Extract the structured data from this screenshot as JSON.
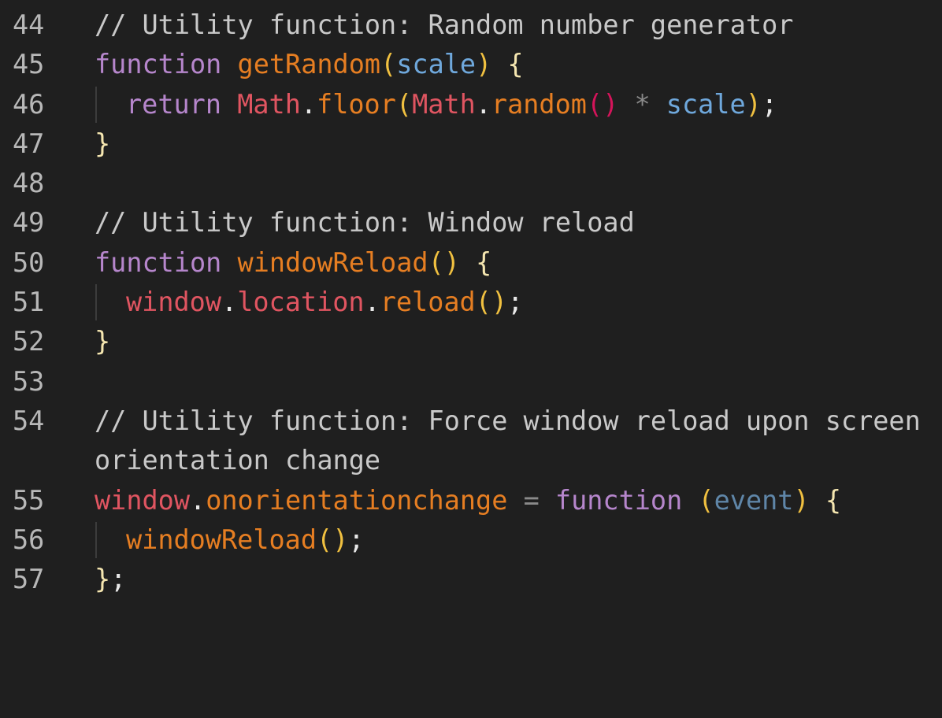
{
  "lines": [
    {
      "number": "44",
      "tokens": [
        "// Utility function: Random number generator"
      ]
    },
    {
      "number": "45",
      "tokens": [
        "function",
        " ",
        "getRandom",
        "(",
        "scale",
        ")",
        " ",
        "{"
      ]
    },
    {
      "number": "46",
      "tokens": [
        "return",
        " ",
        "Math",
        ".",
        "floor",
        "(",
        "Math",
        ".",
        "random",
        "()",
        " ",
        "*",
        " ",
        "scale",
        ")",
        ";"
      ]
    },
    {
      "number": "47",
      "tokens": [
        "}"
      ]
    },
    {
      "number": "48",
      "tokens": []
    },
    {
      "number": "49",
      "tokens": [
        "// Utility function: Window reload"
      ]
    },
    {
      "number": "50",
      "tokens": [
        "function",
        " ",
        "windowReload",
        "()",
        " ",
        "{"
      ]
    },
    {
      "number": "51",
      "tokens": [
        "window",
        ".",
        "location",
        ".",
        "reload",
        "()",
        ";"
      ]
    },
    {
      "number": "52",
      "tokens": [
        "}"
      ]
    },
    {
      "number": "53",
      "tokens": []
    },
    {
      "number": "54",
      "tokens": [
        "// Utility function: Force window reload upon screen",
        "orientation change"
      ]
    },
    {
      "number": "55",
      "tokens": [
        "window",
        ".",
        "onorientationchange",
        " ",
        "=",
        " ",
        "function",
        " ",
        "(",
        "event",
        ")",
        " ",
        "{"
      ]
    },
    {
      "number": "56",
      "tokens": [
        "windowReload",
        "()",
        ";"
      ]
    },
    {
      "number": "57",
      "tokens": [
        "}",
        ";"
      ]
    }
  ],
  "colors": {
    "background": "#1f1f1f",
    "line_number": "#b8b8b8",
    "comment": "#c9c9c9",
    "keyword": "#b686cc",
    "function_name": "#e67e22",
    "parameter": "#6fa8dc",
    "bracket": "#f0c040",
    "object": "#e05561"
  }
}
